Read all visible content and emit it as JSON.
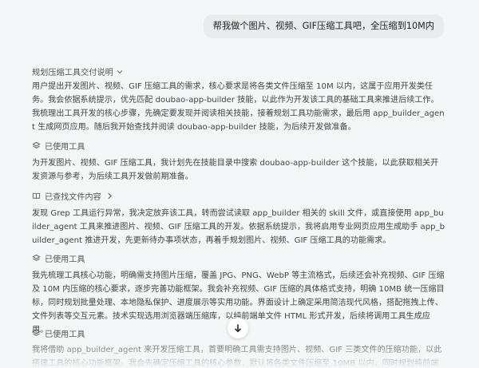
{
  "user_message": "帮我做个图片、视频、GIF压缩工具吧，全压缩到10M内",
  "delivery_header": "规划压缩工具交付说明",
  "paragraphs": [
    "用户提出开发图片、视频、GIF 压缩工具的需求，核心要求是将各类文件压缩至 10M 以内，这属于应用开发类任务。我会依据系统提示，优先匹配 doubao-app-builder 技能，以此作为开发该工具的基础工具来推进后续工作。我梳理出工具开发的核心步骤，先确定要发现并阅读相关技能，接着规划工具功能需求，最后用 app_builder_agent 生成网页应用。随后我开始查找并阅读 doubao-app-builder 技能，为后续开发做准备。",
    "为开发图片、视频、GIF 压缩工具，我计划先在技能目录中搜索 doubao-app-builder 这个技能，以此获取相关开发资源与参考，为后续工具开发做前期准备。",
    "发现 Grep 工具运行异常，我决定放弃该工具，转而尝试读取 app_builder 相关的 skill 文件，或直接使用 app_builder_agent 工具来推进图片、视频、GIF 压缩工具的开发。依据系统提示，我将启用专业网页应用生成助手 app_builder_agent 推进开发，先更新待办事项状态，再着手规划图片、视频、GIF 压缩工具的功能需求。",
    "我先梳理工具核心功能，明确需支持图片压缩，覆盖 JPG、PNG、WebP 等主流格式，后续还会补充视频、GIF 压缩及 10M 内压缩的核心要求，逐步完善功能框架。我会补充视频、GIF 压缩的具体格式支持，明确 10MB 统一压缩目标，同时规划批量处理、本地隐私保护、进度展示等实用功能。界面设计上确定采用简洁现代风格，搭配拖拽上传、文件列表等交互元素。技术实现选用浏览器端压缩库，以纯前端单文件 HTML 形式开发，后续将调用工具生成应用。",
    "我将借助 app_builder_agent 来开发压缩工具，首要明确工具需支持图片、视频、GIF 三类文件的压缩功能，以此搭建工具的核心功能框架。我会先确定压缩工具的核心参数，默认将各类文件压缩至 10MB 以内，同时规划纯前端本地处理、拖拽上传"
  ],
  "tool_used_label": "已使用工具",
  "files_viewed_label": "已查找文件内容",
  "icons": {
    "chevron": "chevron-down-icon",
    "tool": "layers-icon",
    "book": "book-icon",
    "scroll": "arrow-down-icon"
  }
}
